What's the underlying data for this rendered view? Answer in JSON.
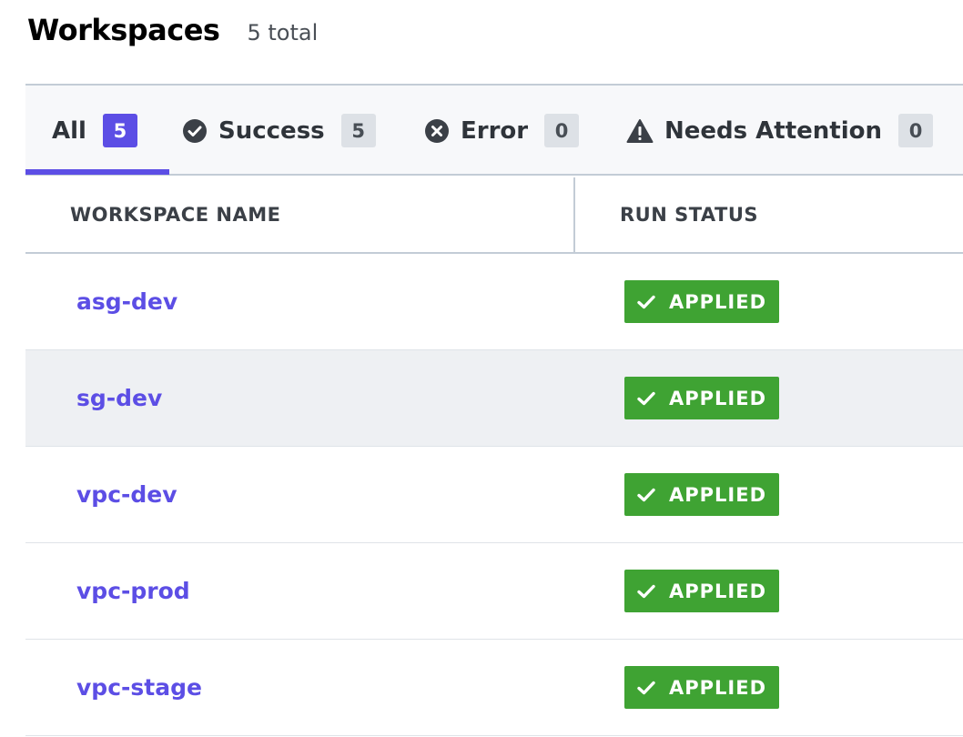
{
  "header": {
    "title": "Workspaces",
    "total": "5 total"
  },
  "tabs": [
    {
      "label": "All",
      "count": "5",
      "icon": null,
      "active": true
    },
    {
      "label": "Success",
      "count": "5",
      "icon": "check-circle-icon",
      "active": false
    },
    {
      "label": "Error",
      "count": "0",
      "icon": "x-circle-icon",
      "active": false
    },
    {
      "label": "Needs Attention",
      "count": "0",
      "icon": "warning-triangle-icon",
      "active": false
    }
  ],
  "table": {
    "columns": [
      "WORKSPACE NAME",
      "RUN STATUS"
    ],
    "rows": [
      {
        "name": "asg-dev",
        "status": "APPLIED"
      },
      {
        "name": "sg-dev",
        "status": "APPLIED"
      },
      {
        "name": "vpc-dev",
        "status": "APPLIED"
      },
      {
        "name": "vpc-prod",
        "status": "APPLIED"
      },
      {
        "name": "vpc-stage",
        "status": "APPLIED"
      }
    ]
  },
  "colors": {
    "accent": "#5c4ee5",
    "success": "#3fa333",
    "row_highlight": "#eef0f3"
  }
}
